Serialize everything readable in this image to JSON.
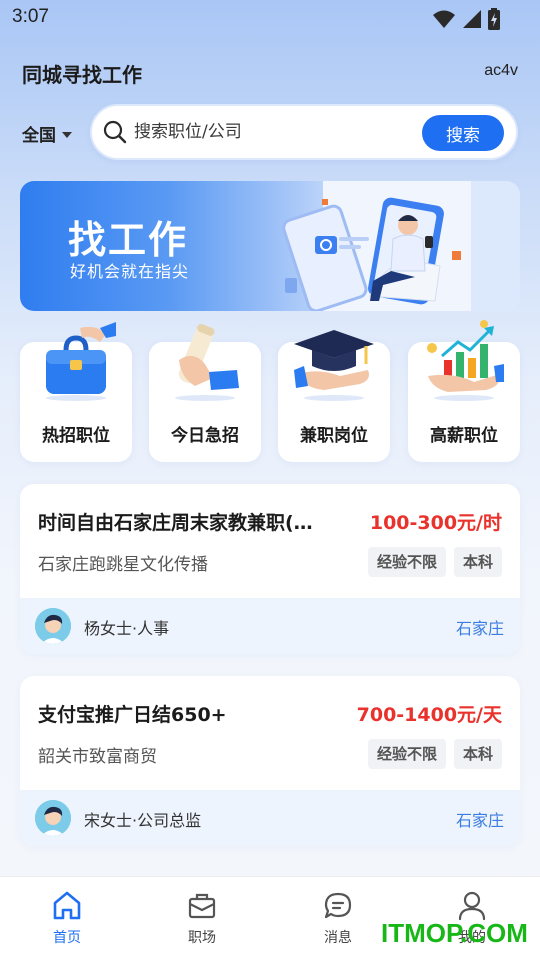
{
  "status_bar": {
    "time": "3:07"
  },
  "header": {
    "title": "同城寻找工作",
    "right_text": "ac4v"
  },
  "search": {
    "region": "全国",
    "placeholder": "搜索职位/公司",
    "button_label": "搜索"
  },
  "banner": {
    "title": "找工作",
    "subtitle": "好机会就在指尖"
  },
  "categories": [
    {
      "label": "热招职位",
      "icon": "briefcase-icon"
    },
    {
      "label": "今日急招",
      "icon": "scroll-icon"
    },
    {
      "label": "兼职岗位",
      "icon": "graduation-cap-icon"
    },
    {
      "label": "高薪职位",
      "icon": "chart-coins-icon"
    }
  ],
  "jobs": [
    {
      "title": "时间自由石家庄周末家教兼职(…",
      "salary": "100-300元/时",
      "company": "石家庄跑跳星文化传播",
      "tags": [
        "经验不限",
        "本科"
      ],
      "recruiter": "杨女士·人事",
      "city": "石家庄"
    },
    {
      "title": "支付宝推广日结650+",
      "salary": "700-1400元/天",
      "company": "韶关市致富商贸",
      "tags": [
        "经验不限",
        "本科"
      ],
      "recruiter": "宋女士·公司总监",
      "city": "石家庄"
    }
  ],
  "bottom_nav": [
    {
      "label": "首页",
      "icon": "home-icon",
      "active": true
    },
    {
      "label": "职场",
      "icon": "briefcase-outline-icon",
      "active": false
    },
    {
      "label": "消息",
      "icon": "chat-bubble-icon",
      "active": false
    },
    {
      "label": "我的",
      "icon": "person-icon",
      "active": false
    }
  ],
  "watermark": "ITMOP.COM",
  "colors": {
    "accent": "#1f6ff2",
    "salary": "#e8322b",
    "city": "#3b7ce0",
    "watermark": "#18b718"
  }
}
